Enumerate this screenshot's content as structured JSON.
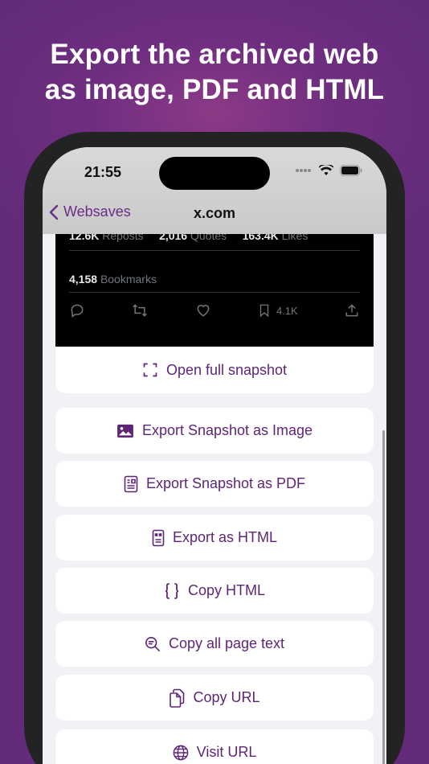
{
  "headline": {
    "line1": "Export the archived web",
    "line2": "as image, PDF and HTML"
  },
  "status_bar": {
    "time": "21:55"
  },
  "nav": {
    "back_label": "Websaves",
    "title": "x.com"
  },
  "tweet": {
    "reposts_count": "12.6K",
    "reposts_label": "Reposts",
    "quotes_count": "2,016",
    "quotes_label": "Quotes",
    "likes_count": "163.4K",
    "likes_label": "Likes",
    "bookmarks_count": "4,158",
    "bookmarks_label": "Bookmarks",
    "bookmark_action_count": "4.1K"
  },
  "open_snapshot_label": "Open full snapshot",
  "actions": {
    "export_image": "Export Snapshot as Image",
    "export_pdf": "Export Snapshot as PDF",
    "export_html": "Export as HTML",
    "copy_html": "Copy HTML",
    "copy_text": "Copy all page text",
    "copy_url": "Copy URL",
    "visit_url": "Visit URL"
  },
  "colors": {
    "background": "#662c7c",
    "accent": "#5e2577",
    "screen": "#f2f1f6",
    "tweet_bg": "#000000"
  },
  "icons": [
    "chevron-left-icon",
    "signal-icon",
    "wifi-icon",
    "battery-icon",
    "reply-icon",
    "repost-icon",
    "like-icon",
    "bookmark-icon",
    "share-icon",
    "fullscreen-icon",
    "image-icon",
    "pdf-icon",
    "html-file-icon",
    "curly-braces-icon",
    "text-search-icon",
    "copy-doc-icon",
    "globe-icon"
  ]
}
